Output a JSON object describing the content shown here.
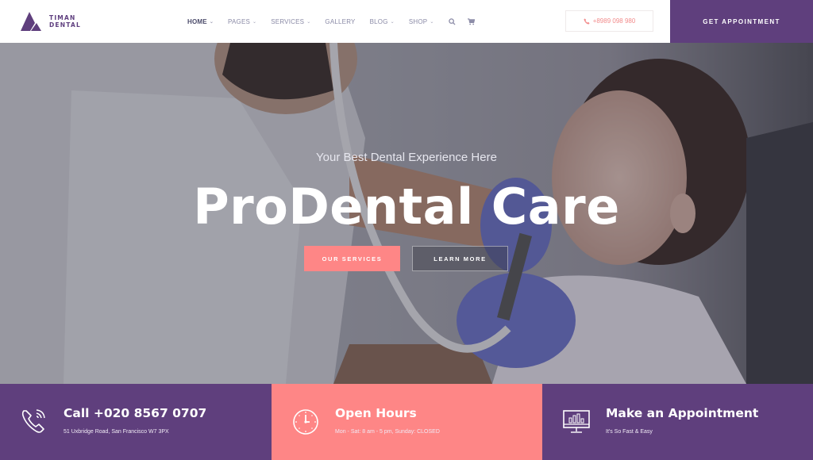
{
  "brand": {
    "line1": "TIMAN",
    "line2": "DENTAL",
    "color": "#5f3f7d"
  },
  "nav": {
    "items": [
      {
        "label": "HOME",
        "has_dropdown": true,
        "active": true
      },
      {
        "label": "PAGES",
        "has_dropdown": true
      },
      {
        "label": "SERVICES",
        "has_dropdown": true
      },
      {
        "label": "GALLERY",
        "has_dropdown": false
      },
      {
        "label": "BLOG",
        "has_dropdown": true
      },
      {
        "label": "SHOP",
        "has_dropdown": true
      }
    ],
    "chevron": "⌄",
    "icons": [
      "search-icon",
      "cart-icon"
    ]
  },
  "header": {
    "phone": "+8989 098 980",
    "cta": "GET APPOINTMENT"
  },
  "hero": {
    "subtitle": "Your Best Dental Experience Here",
    "title": "ProDental Care",
    "buttons": {
      "primary": "OUR SERVICES",
      "secondary": "LEARN MORE"
    }
  },
  "info": [
    {
      "icon": "phone-call-icon",
      "title": "Call +020 8567 0707",
      "text": "51 Uxbridge Road, San Francisco W7 3PX"
    },
    {
      "icon": "clock-icon",
      "title": "Open Hours",
      "text": "Mon - Sat: 8 am - 5 pm, Sunday: CLOSED"
    },
    {
      "icon": "monitor-chart-icon",
      "title": "Make an Appointment",
      "text": "It's So Fast & Easy"
    }
  ],
  "colors": {
    "purple": "#5f3f7d",
    "coral": "#fe8686",
    "nav_text": "#8a8aa6"
  }
}
